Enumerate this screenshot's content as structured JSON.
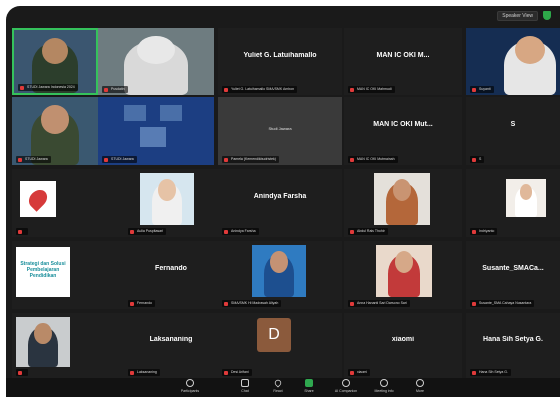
{
  "window": {
    "view_button": "Speaker View"
  },
  "tiles": {
    "t1_label": "STUDI Jawara Indonesia 2024",
    "t2_label": "Pusdatin",
    "t3_name": "Yuliet G. Latuihamallo",
    "t3_label": "Yuliet G. Latuihamallo SMA/SMK Ambon",
    "t4_name": "MAN IC OKI M...",
    "t4_label": "MAN IC OKI Mahmudi",
    "t5_label": "Suyanti",
    "t6_label": "STUDI Jawara",
    "t7_label": "STUDI Jawara",
    "t8_label": "",
    "t8_screen_title": "Studi Jawara",
    "t9_label": "Pamela (Kemendikbudristek)",
    "t10_name": "MAN IC OKI Mut...",
    "t10_label": "MAN IC OKI Mutmainah",
    "t11_name": "S",
    "t11_label": "S",
    "t12_label": "",
    "t13_label": "Aulia Puspitasari",
    "t14_name": "Anindya Farsha",
    "t14_label": "Anindya Farsha",
    "t15_label": "Abdul Rais Thohir",
    "t16_label": "Indriyanto",
    "t17_banner": "Strategi dan Solusi Pembelajaran Pendidikan",
    "t18_name": "Fernando",
    "t18_label": "Fernando",
    "t19_label": "SMA/SMK Hi Madrasah Aliyah",
    "t20_label": "Anna Hananti Sari Darsono Sari",
    "t21_name": "Susante_SMACa...",
    "t21_label": "Susante_SMA Cahaya Nusantara",
    "t22_label": "",
    "t23_name": "Laksananing",
    "t23_label": "Laksananing",
    "t24_avatar": "D",
    "t24_label": "Desi Arifani",
    "t25_name": "xiaomi",
    "t25_label": "xiaomi",
    "t26_name": "Hana Sih Setya G.",
    "t26_label": "Hana Sih Setya G."
  },
  "toolbar": {
    "participants": "Participants",
    "chat": "Chat",
    "react": "React",
    "share": "Share",
    "ai_companion": "AI Companion",
    "meeting_info": "Meeting info",
    "more": "More"
  },
  "colors": {
    "background": "#1a1a1a",
    "active_speaker_border": "#35c25c",
    "muted_red": "#e03a3a",
    "share_green": "#2fa84f"
  }
}
